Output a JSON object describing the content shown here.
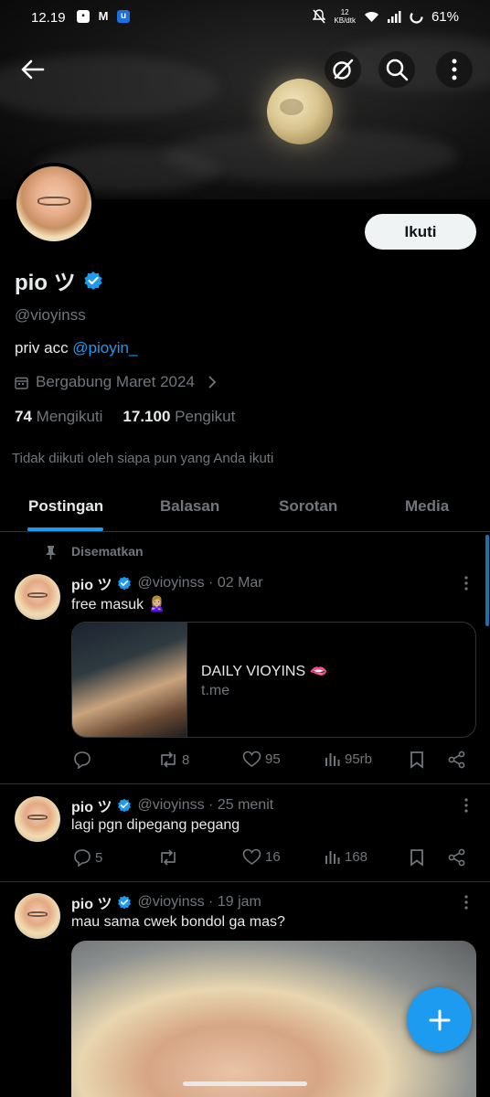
{
  "status_bar": {
    "time": "12.19",
    "speed_value": "12",
    "speed_unit": "KB/dtk",
    "battery": "61%"
  },
  "header": {
    "back_icon": "arrow-left-icon",
    "grok_icon": "grok-icon",
    "search_icon": "search-icon",
    "more_icon": "more-vertical-icon"
  },
  "profile": {
    "name": "pio ツ",
    "handle": "@vioyinss",
    "bio_text": "priv acc ",
    "bio_link": "@pioyin_",
    "joined": "Bergabung Maret 2024",
    "following_count": "74",
    "following_label": "Mengikuti",
    "followers_count": "17.100",
    "followers_label": "Pengikut",
    "not_followed": "Tidak diikuti oleh siapa pun yang Anda ikuti",
    "follow_button": "Ikuti"
  },
  "tabs": [
    "Postingan",
    "Balasan",
    "Sorotan",
    "Media"
  ],
  "posts": [
    {
      "pinned_label": "Disematkan",
      "name": "pio ツ",
      "meta": "@vioyinss · 02 Mar",
      "text": "free masuk 🙎🏼‍♀️",
      "card_title": "DAILY VIOYINS 🫦",
      "card_domain": "t.me",
      "replies": "",
      "reposts": "8",
      "likes": "95",
      "views": "95rb"
    },
    {
      "name": "pio ツ",
      "meta": "@vioyinss · 25 menit",
      "text": "lagi pgn dipegang pegang",
      "replies": "5",
      "reposts": "",
      "likes": "16",
      "views": "168"
    },
    {
      "name": "pio ツ",
      "meta": "@vioyinss · 19 jam",
      "text": "mau sama cwek bondol ga mas?"
    }
  ],
  "colors": {
    "accent": "#1d9bf0",
    "background": "#000000",
    "muted": "#71767b",
    "text": "#e7e9ea",
    "border": "#2f3336"
  }
}
